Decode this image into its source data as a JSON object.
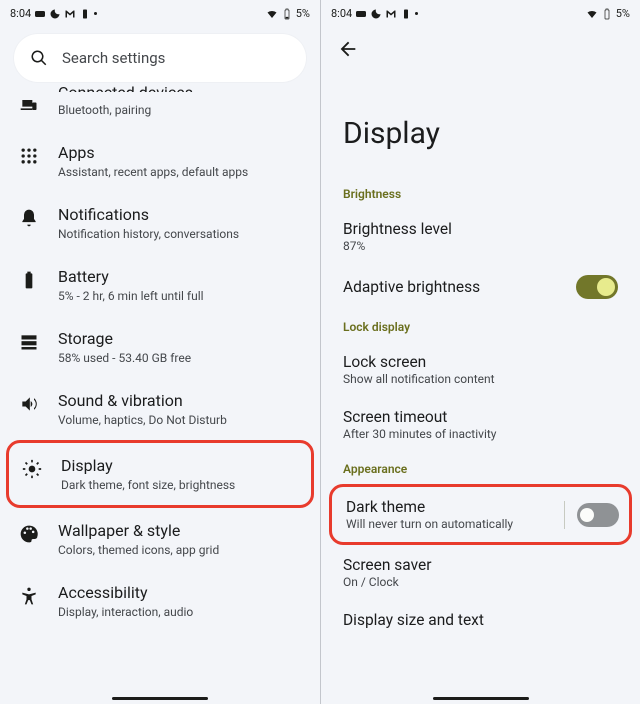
{
  "status": {
    "time": "8:04",
    "battery": "5%"
  },
  "search": {
    "placeholder": "Search settings"
  },
  "settings": {
    "connected": {
      "title": "Connected devices",
      "sub": "Bluetooth, pairing"
    },
    "apps": {
      "title": "Apps",
      "sub": "Assistant, recent apps, default apps"
    },
    "notifications": {
      "title": "Notifications",
      "sub": "Notification history, conversations"
    },
    "battery": {
      "title": "Battery",
      "sub": "5% - 2 hr, 6 min left until full"
    },
    "storage": {
      "title": "Storage",
      "sub": "58% used - 53.40 GB free"
    },
    "sound": {
      "title": "Sound & vibration",
      "sub": "Volume, haptics, Do Not Disturb"
    },
    "display": {
      "title": "Display",
      "sub": "Dark theme, font size, brightness"
    },
    "wallpaper": {
      "title": "Wallpaper & style",
      "sub": "Colors, themed icons, app grid"
    },
    "accessibility": {
      "title": "Accessibility",
      "sub": "Display, interaction, audio"
    }
  },
  "displayPage": {
    "title": "Display",
    "sections": {
      "brightness": "Brightness",
      "lock": "Lock display",
      "appearance": "Appearance"
    },
    "brightnessLevel": {
      "title": "Brightness level",
      "sub": "87%"
    },
    "adaptive": {
      "title": "Adaptive brightness"
    },
    "lockScreen": {
      "title": "Lock screen",
      "sub": "Show all notification content"
    },
    "timeout": {
      "title": "Screen timeout",
      "sub": "After 30 minutes of inactivity"
    },
    "darkTheme": {
      "title": "Dark theme",
      "sub": "Will never turn on automatically"
    },
    "screenSaver": {
      "title": "Screen saver",
      "sub": "On / Clock"
    },
    "displaySize": {
      "title": "Display size and text"
    }
  }
}
